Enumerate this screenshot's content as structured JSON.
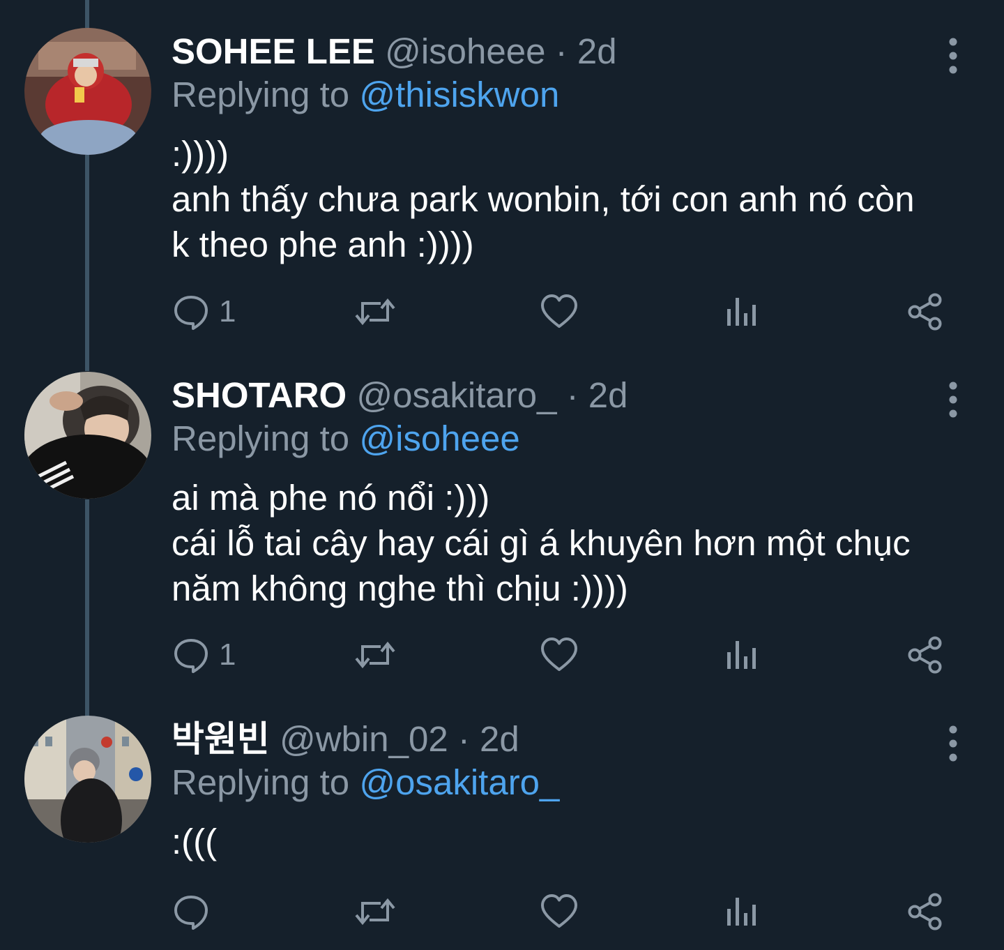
{
  "colors": {
    "background": "#15202b",
    "thread_line": "#3d5466",
    "secondary_text": "#8b98a5",
    "mention": "#4ea4ee"
  },
  "tweets": [
    {
      "name": "SOHEE LEE",
      "handle": "@isoheee",
      "sep": " · ",
      "time": "2d",
      "replying_prefix": "Replying to ",
      "replying_to": "@thisiskwon",
      "lines": [
        ":))))",
        "anh thấy chưa park wonbin, tới con anh nó còn",
        "k theo phe anh :))))"
      ],
      "reply_count": "1",
      "icons": [
        "reply-icon",
        "retweet-icon",
        "like-icon",
        "views-icon",
        "share-icon",
        "more-icon"
      ]
    },
    {
      "name": "SHOTARO",
      "handle": "@osakitaro_",
      "sep": " · ",
      "time": "2d",
      "replying_prefix": "Replying to ",
      "replying_to": "@isoheee",
      "lines": [
        "ai mà phe nó nổi :)))",
        "cái lỗ tai cây hay cái gì á khuyên hơn một chục",
        "năm không nghe thì chịu :))))"
      ],
      "reply_count": "1",
      "icons": [
        "reply-icon",
        "retweet-icon",
        "like-icon",
        "views-icon",
        "share-icon",
        "more-icon"
      ]
    },
    {
      "name": "박원빈",
      "handle": "@wbin_02",
      "sep": " · ",
      "time": "2d",
      "replying_prefix": "Replying to ",
      "replying_to": "@osakitaro_",
      "lines": [
        ":((("
      ],
      "reply_count": "",
      "icons": [
        "reply-icon",
        "retweet-icon",
        "like-icon",
        "views-icon",
        "share-icon",
        "more-icon"
      ]
    }
  ]
}
